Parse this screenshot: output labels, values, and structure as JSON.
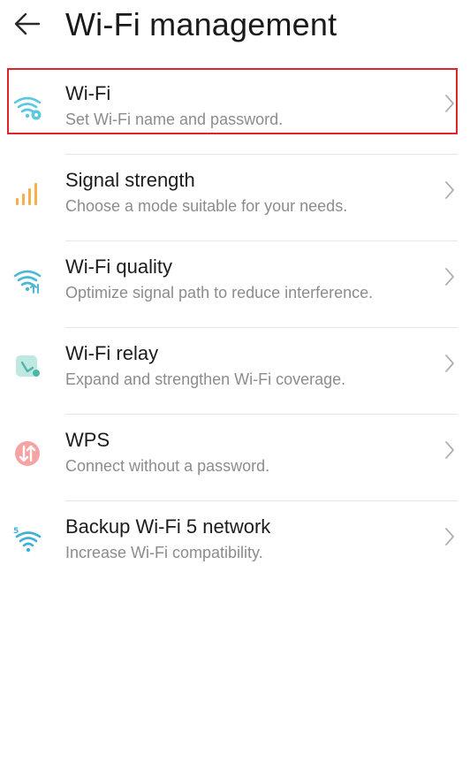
{
  "header": {
    "back_icon": "arrow-left-icon",
    "title": "Wi-Fi management"
  },
  "items": [
    {
      "title": "Wi-Fi",
      "subtitle": "Set Wi-Fi name and password.",
      "icon": "wifi-settings-icon",
      "color": "#5ac8e0"
    },
    {
      "title": "Signal strength",
      "subtitle": "Choose a mode suitable for your needs.",
      "icon": "signal-bars-icon",
      "color": "#f5b04a"
    },
    {
      "title": "Wi-Fi quality",
      "subtitle": "Optimize signal path to reduce interference.",
      "icon": "wifi-quality-icon",
      "color": "#4cb8d8"
    },
    {
      "title": "Wi-Fi relay",
      "subtitle": "Expand and strengthen Wi-Fi coverage.",
      "icon": "wifi-relay-icon",
      "color": "#7ad3c2"
    },
    {
      "title": "WPS",
      "subtitle": "Connect without a password.",
      "icon": "wps-icon",
      "color": "#f08a8a"
    },
    {
      "title": "Backup Wi-Fi 5 network",
      "subtitle": "Increase Wi-Fi compatibility.",
      "icon": "wifi-5-icon",
      "color": "#3fb0d8"
    }
  ],
  "highlight_color": "#e0242b"
}
